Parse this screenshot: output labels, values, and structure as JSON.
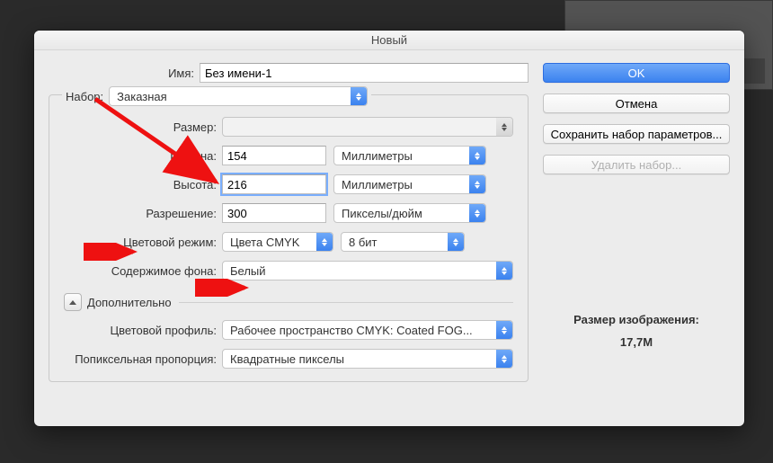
{
  "dialog": {
    "title": "Новый",
    "name_label": "Имя:",
    "name_value": "Без имени-1",
    "preset_label": "Набор:",
    "preset_value": "Заказная",
    "size_label": "Размер:",
    "size_value": "",
    "width_label": "Ширина:",
    "width_value": "154",
    "width_unit": "Миллиметры",
    "height_label": "Высота:",
    "height_value": "216",
    "height_unit": "Миллиметры",
    "resolution_label": "Разрешение:",
    "resolution_value": "300",
    "resolution_unit": "Пикселы/дюйм",
    "colormode_label": "Цветовой режим:",
    "colormode_value": "Цвета CMYK",
    "bitdepth_value": "8 бит",
    "background_label": "Содержимое фона:",
    "background_value": "Белый",
    "advanced_label": "Дополнительно",
    "profile_label": "Цветовой профиль:",
    "profile_value": "Рабочее пространство CMYK:  Coated FOG...",
    "pixelaspect_label": "Попиксельная пропорция:",
    "pixelaspect_value": "Квадратные пикселы"
  },
  "buttons": {
    "ok": "OK",
    "cancel": "Отмена",
    "save_preset": "Сохранить набор параметров...",
    "delete_preset": "Удалить набор..."
  },
  "info": {
    "size_label": "Размер изображения:",
    "size_value": "17,7M"
  }
}
